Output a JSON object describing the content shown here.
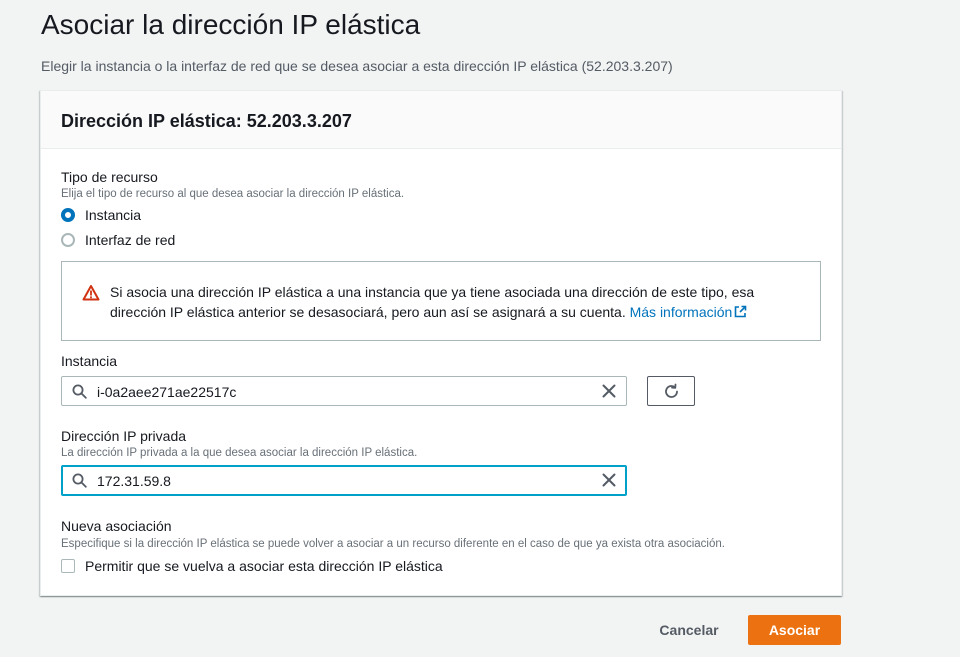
{
  "page": {
    "title": "Asociar la dirección IP elástica",
    "description": "Elegir la instancia o la interfaz de red que se desea asociar a esta dirección IP elástica (52.203.3.207)"
  },
  "panel": {
    "title": "Dirección IP elástica: 52.203.3.207"
  },
  "resource_type": {
    "label": "Tipo de recurso",
    "description": "Elija el tipo de recurso al que desea asociar la dirección IP elástica.",
    "options": [
      {
        "label": "Instancia",
        "selected": true
      },
      {
        "label": "Interfaz de red",
        "selected": false
      }
    ]
  },
  "alert": {
    "icon": "warning-triangle-icon",
    "text": "Si asocia una dirección IP elástica a una instancia que ya tiene asociada una dirección de este tipo, esa dirección IP elástica anterior se desasociará, pero aun así se asignará a su cuenta.",
    "link_label": "Más información",
    "color": "#d13212"
  },
  "instance": {
    "label": "Instancia",
    "value": "i-0a2aee271ae22517c"
  },
  "private_ip": {
    "label": "Dirección IP privada",
    "description": "La dirección IP privada a la que desea asociar la dirección IP elástica.",
    "value": "172.31.59.8"
  },
  "reassociation": {
    "label": "Nueva asociación",
    "description": "Especifique si la dirección IP elástica se puede volver a asociar a un recurso diferente en el caso de que ya exista otra asociación.",
    "checkbox_label": "Permitir que se vuelva a asociar esta dirección IP elástica",
    "checked": false
  },
  "actions": {
    "cancel_label": "Cancelar",
    "submit_label": "Asociar",
    "accent": "#ec7211"
  }
}
